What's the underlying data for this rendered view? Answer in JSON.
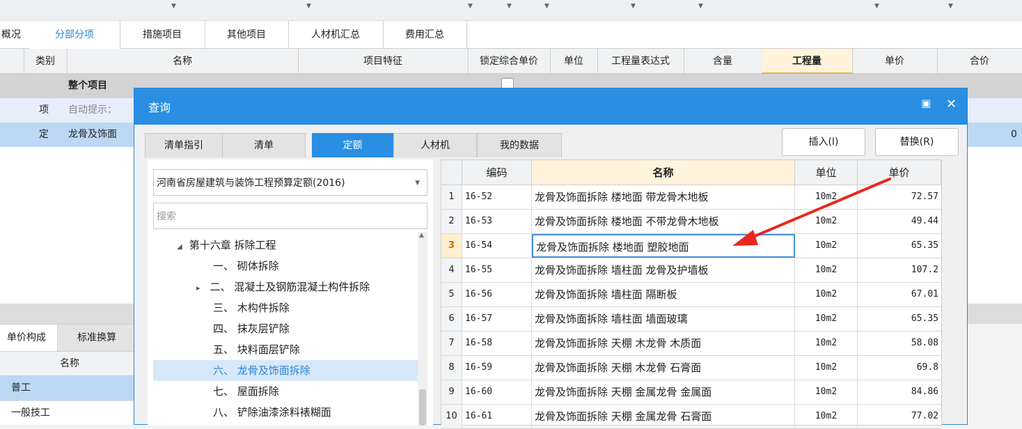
{
  "main_tabs": [
    {
      "label": "概况"
    },
    {
      "label": "分部分项"
    },
    {
      "label": "措施项目"
    },
    {
      "label": "其他项目"
    },
    {
      "label": "人材机汇总"
    },
    {
      "label": "费用汇总"
    }
  ],
  "grid": {
    "headers": [
      "类别",
      "名称",
      "项目特征",
      "锁定综合单价",
      "单位",
      "工程量表达式",
      "含量",
      "工程量",
      "单价",
      "合价"
    ],
    "rows": [
      {
        "category": "",
        "name": "整个项目"
      },
      {
        "category": "项",
        "name": "自动提示："
      },
      {
        "category": "定",
        "name": "龙骨及饰面",
        "total": "0"
      }
    ]
  },
  "lower_panel": {
    "tabs": [
      "单价构成",
      "标准换算"
    ],
    "header": "名称",
    "rows": [
      "普工",
      "一般技工"
    ]
  },
  "dialog": {
    "title": "查询",
    "tabs": [
      "清单指引",
      "清单",
      "定额",
      "人材机",
      "我的数据"
    ],
    "insert_button": "插入(I)",
    "replace_button": "替换(R)",
    "quota_select": "河南省房屋建筑与装饰工程预算定额(2016)",
    "search_placeholder": "搜索",
    "tree": [
      {
        "label": "第十六章 拆除工程",
        "arrow": "◢"
      },
      {
        "label": "一、 砌体拆除",
        "arrow": ""
      },
      {
        "label": "二、 混凝土及钢筋混凝土构件拆除",
        "arrow": "▸"
      },
      {
        "label": "三、 木构件拆除",
        "arrow": ""
      },
      {
        "label": "四、 抹灰层铲除",
        "arrow": ""
      },
      {
        "label": "五、 块料面层铲除",
        "arrow": ""
      },
      {
        "label": "六、 龙骨及饰面拆除",
        "arrow": ""
      },
      {
        "label": "七、 屋面拆除",
        "arrow": ""
      },
      {
        "label": "八、 铲除油漆涂料裱糊面",
        "arrow": ""
      }
    ],
    "table": {
      "headers": [
        "编码",
        "名称",
        "单位",
        "单价"
      ],
      "rows": [
        {
          "idx": "1",
          "code": "16-52",
          "name": "龙骨及饰面拆除 楼地面 带龙骨木地板",
          "unit": "10m2",
          "price": "72.57"
        },
        {
          "idx": "2",
          "code": "16-53",
          "name": "龙骨及饰面拆除 楼地面 不带龙骨木地板",
          "unit": "10m2",
          "price": "49.44"
        },
        {
          "idx": "3",
          "code": "16-54",
          "name": "龙骨及饰面拆除 楼地面 塑胶地面",
          "unit": "10m2",
          "price": "65.35"
        },
        {
          "idx": "4",
          "code": "16-55",
          "name": "龙骨及饰面拆除 墙柱面 龙骨及护墙板",
          "unit": "10m2",
          "price": "107.2"
        },
        {
          "idx": "5",
          "code": "16-56",
          "name": "龙骨及饰面拆除 墙柱面 隔断板",
          "unit": "10m2",
          "price": "67.01"
        },
        {
          "idx": "6",
          "code": "16-57",
          "name": "龙骨及饰面拆除 墙柱面 墙面玻璃",
          "unit": "10m2",
          "price": "65.35"
        },
        {
          "idx": "7",
          "code": "16-58",
          "name": "龙骨及饰面拆除 天棚 木龙骨 木质面",
          "unit": "10m2",
          "price": "58.08"
        },
        {
          "idx": "8",
          "code": "16-59",
          "name": "龙骨及饰面拆除 天棚 木龙骨 石膏面",
          "unit": "10m2",
          "price": "69.8"
        },
        {
          "idx": "9",
          "code": "16-60",
          "name": "龙骨及饰面拆除 天棚 金属龙骨 金属面",
          "unit": "10m2",
          "price": "84.86"
        },
        {
          "idx": "10",
          "code": "16-61",
          "name": "龙骨及饰面拆除 天棚 金属龙骨 石膏面",
          "unit": "10m2",
          "price": "77.02"
        }
      ]
    }
  },
  "colors": {
    "accent": "#2a8ee2",
    "arrow": "#e8281e",
    "highlight": "#fff3dc"
  }
}
